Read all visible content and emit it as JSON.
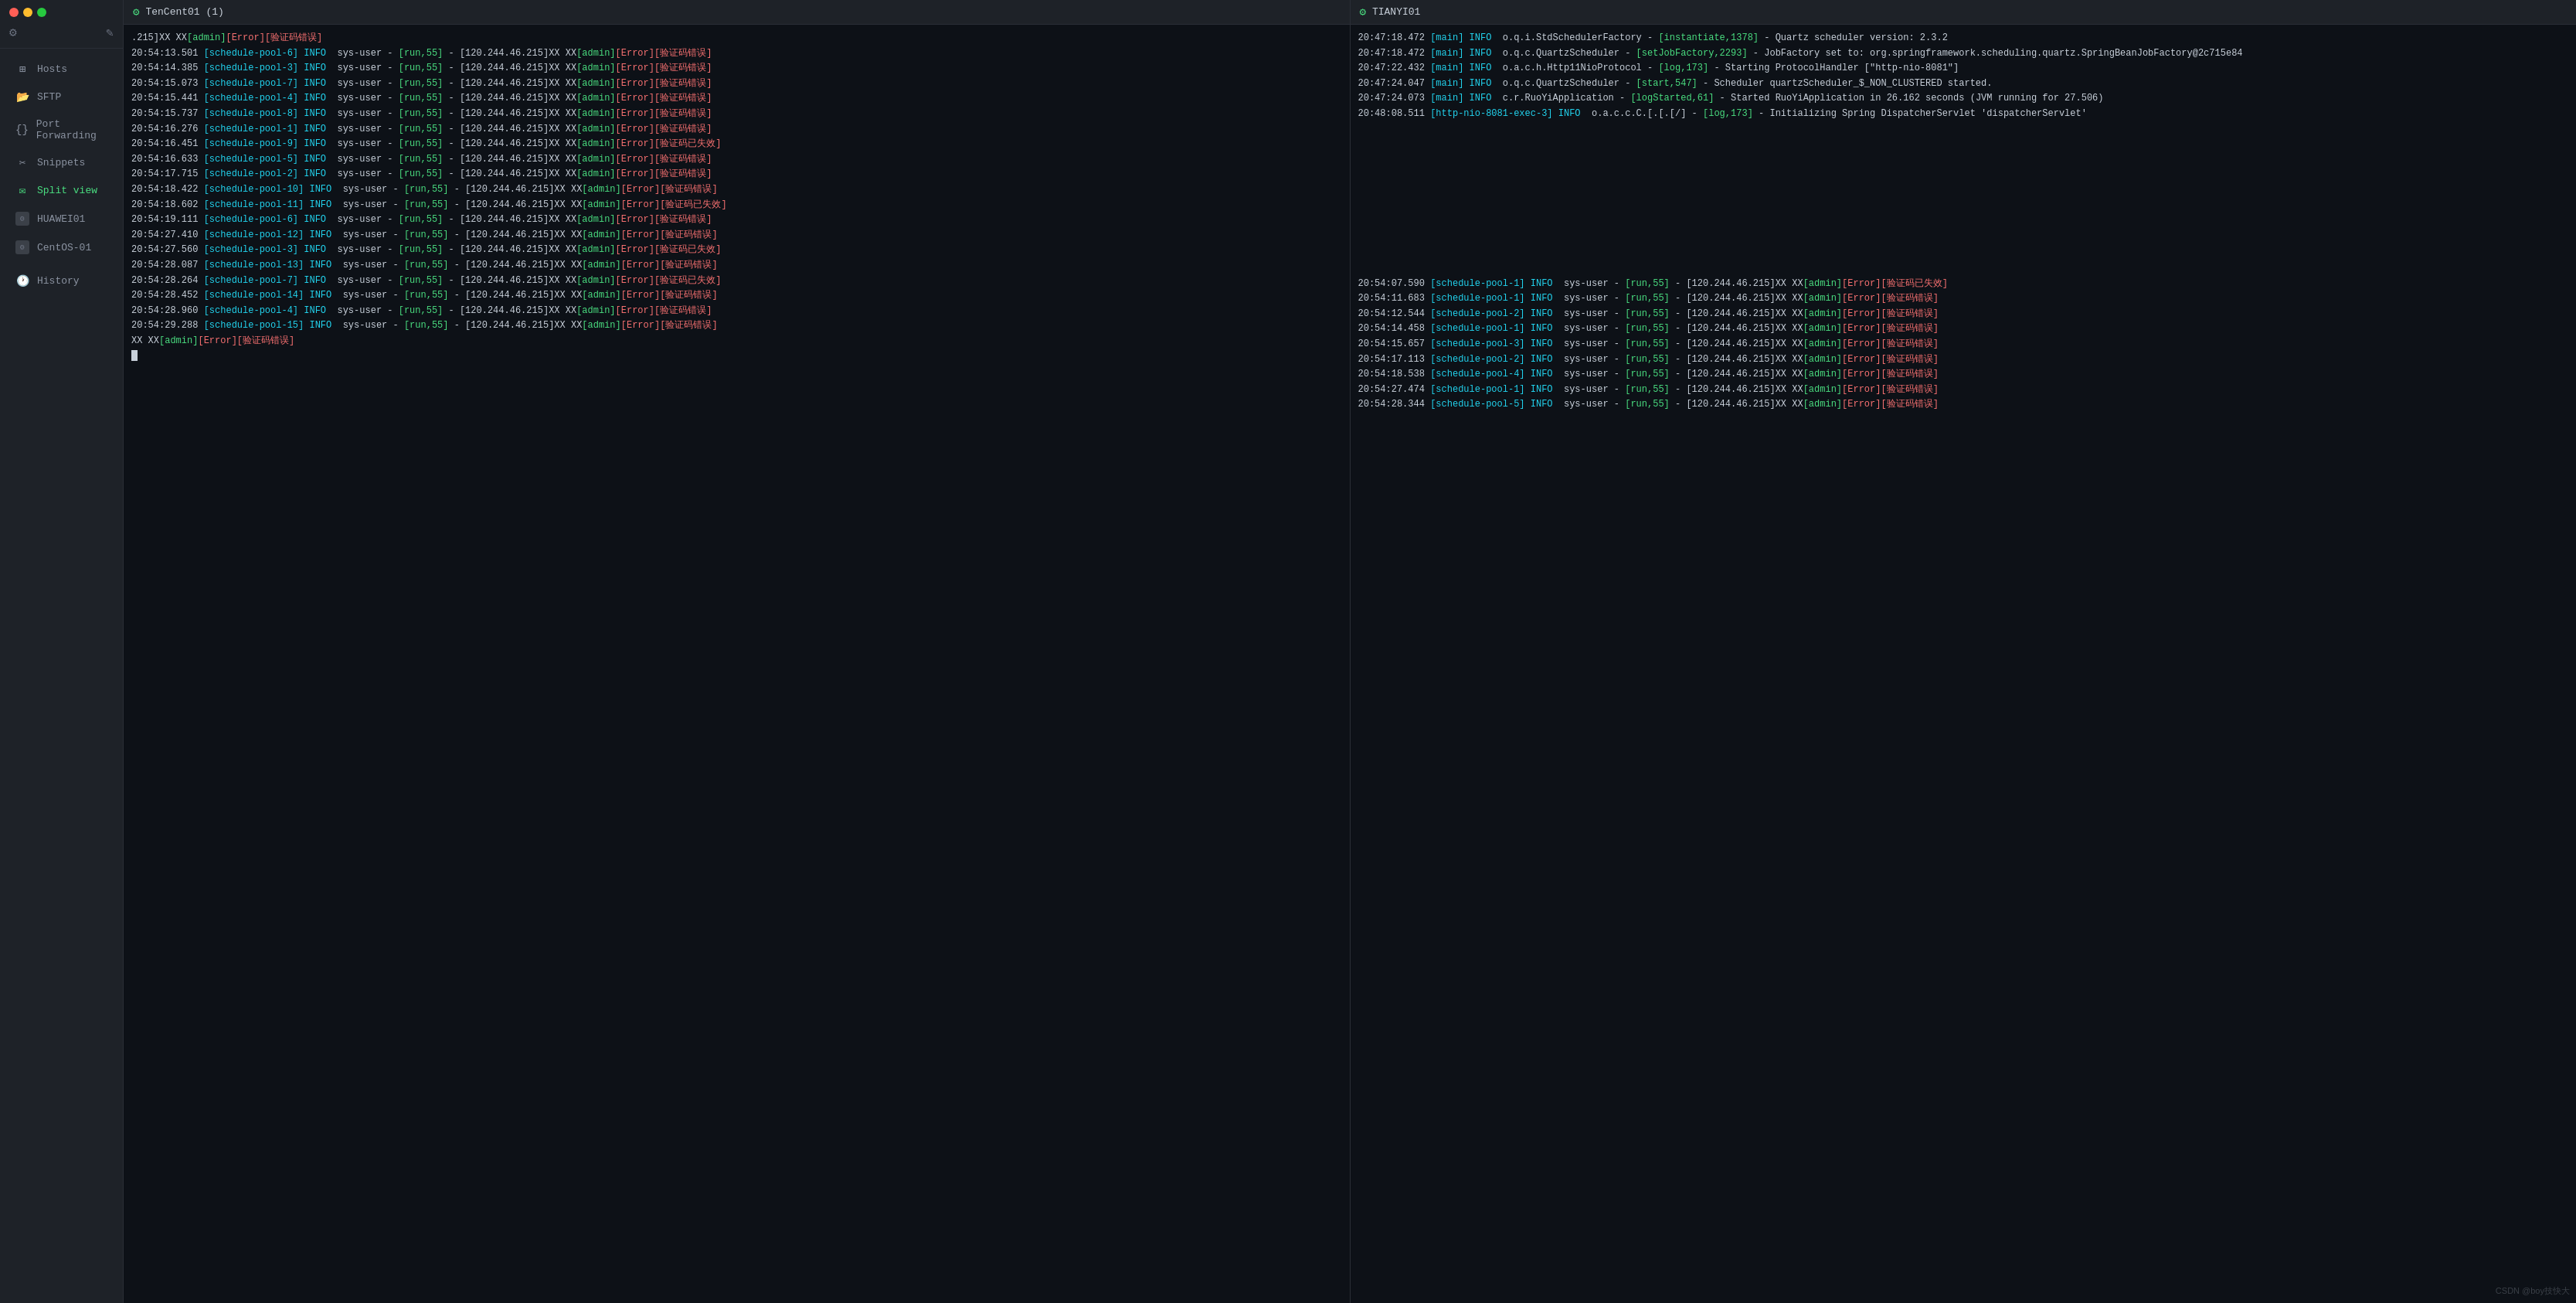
{
  "sidebar": {
    "gear_icon": "⚙",
    "edit_icon": "✎",
    "nav_items": [
      {
        "id": "hosts",
        "label": "Hosts",
        "icon": "⊞"
      },
      {
        "id": "sftp",
        "label": "SFTP",
        "icon": "📁"
      },
      {
        "id": "port-forwarding",
        "label": "Port Forwarding",
        "icon": "{}"
      },
      {
        "id": "snippets",
        "label": "Snippets",
        "icon": "✂"
      },
      {
        "id": "split-view",
        "label": "Split view",
        "icon": "✉",
        "active": true
      }
    ],
    "session_items": [
      {
        "id": "huawei01",
        "label": "HUAWEI01"
      },
      {
        "id": "centos-01",
        "label": "CentOS-01"
      }
    ],
    "history_label": "History"
  },
  "left_pane": {
    "title": "TenCent01 (1)",
    "gear_icon": "⚙",
    "logs": [
      ".215]XX XX[admin][Error][验证码错误]",
      "20:54:13.501 [schedule-pool-6] INFO  sys-user - [run,55] - [120.244.46.215]XX XX[admin][Error][验证码错误]",
      "20:54:14.385 [schedule-pool-3] INFO  sys-user - [run,55] - [120.244.46.215]XX XX[admin][Error][验证码错误]",
      "20:54:15.073 [schedule-pool-7] INFO  sys-user - [run,55] - [120.244.46.215]XX XX[admin][Error][验证码错误]",
      "20:54:15.441 [schedule-pool-4] INFO  sys-user - [run,55] - [120.244.46.215]XX XX[admin][Error][验证码错误]",
      "20:54:15.737 [schedule-pool-8] INFO  sys-user - [run,55] - [120.244.46.215]XX XX[admin][Error][验证码错误]",
      "20:54:16.276 [schedule-pool-1] INFO  sys-user - [run,55] - [120.244.46.215]XX XX[admin][Error][验证码错误]",
      "20:54:16.451 [schedule-pool-9] INFO  sys-user - [run,55] - [120.244.46.215]XX XX[admin][Error][验证码已失效]",
      "20:54:16.633 [schedule-pool-5] INFO  sys-user - [run,55] - [120.244.46.215]XX XX[admin][Error][验证码错误]",
      "20:54:17.715 [schedule-pool-2] INFO  sys-user - [run,55] - [120.244.46.215]XX XX[admin][Error][验证码错误]",
      "20:54:18.422 [schedule-pool-10] INFO  sys-user - [run,55] - [120.244.46.215]XX XX[admin][Error][验证码错误]",
      "20:54:18.602 [schedule-pool-11] INFO  sys-user - [run,55] - [120.244.46.215]XX XX[admin][Error][验证码已失效]",
      "20:54:19.111 [schedule-pool-6] INFO  sys-user - [run,55] - [120.244.46.215]XX XX[admin][Error][验证码错误]",
      "20:54:27.410 [schedule-pool-12] INFO  sys-user - [run,55] - [120.244.46.215]XX XX[admin][Error][验证码错误]",
      "20:54:27.560 [schedule-pool-3] INFO  sys-user - [run,55] - [120.244.46.215]XX XX[admin][Error][验证码已失效]",
      "20:54:28.087 [schedule-pool-13] INFO  sys-user - [run,55] - [120.244.46.215]XX XX[admin][Error][验证码错误]",
      "20:54:28.264 [schedule-pool-7] INFO  sys-user - [run,55] - [120.244.46.215]XX XX[admin][Error][验证码已失效]",
      "20:54:28.452 [schedule-pool-14] INFO  sys-user - [run,55] - [120.244.46.215]XX XX[admin][Error][验证码错误]",
      "20:54:28.960 [schedule-pool-4] INFO  sys-user - [run,55] - [120.244.46.215]XX XX[admin][Error][验证码错误]",
      "20:54:29.288 [schedule-pool-15] INFO  sys-user - [run,55] - [120.244.46.215]XX XX[admin][Error][验证码错误]",
      "XX XX[admin][Error][验证码错误]"
    ]
  },
  "right_pane": {
    "title": "TIANYI01",
    "gear_icon": "⚙",
    "logs_top": [
      "20:47:18.472 [main] INFO  o.q.i.StdSchedulerFactory - [instantiate,1378] - Quartz scheduler version: 2.3.2",
      "20:47:18.472 [main] INFO  o.q.c.QuartzScheduler - [setJobFactory,2293] - JobFactory set to: org.springframework.scheduling.quartz.SpringBeanJobFactory@2c715e84",
      "20:47:22.432 [main] INFO  o.a.c.h.Http11NioProtocol - [log,173] - Starting ProtocolHandler [\"http-nio-8081\"]",
      "20:47:24.047 [main] INFO  o.q.c.QuartzScheduler - [start,547] - Scheduler quartzScheduler_$_NON_CLUSTERED started.",
      "20:47:24.073 [main] INFO  c.r.RuoYiApplication - [logStarted,61] - Started RuoYiApplication in 26.162 seconds (JVM running for 27.506)",
      "20:48:08.511 [http-nio-8081-exec-3] INFO  o.a.c.c.C.[.[.[/] - [log,173] - Initializing Spring DispatcherServlet 'dispatcherServlet'"
    ],
    "logs_bottom": [
      "20:54:07.590 [schedule-pool-1] INFO  sys-user - [run,55] - [120.244.46.215]XX XX[admin][Error][验证码已失效]",
      "20:54:11.683 [schedule-pool-1] INFO  sys-user - [run,55] - [120.244.46.215]XX XX[admin][Error][验证码错误]",
      "20:54:12.544 [schedule-pool-2] INFO  sys-user - [run,55] - [120.244.46.215]XX XX[admin][Error][验证码错误]",
      "20:54:14.458 [schedule-pool-1] INFO  sys-user - [run,55] - [120.244.46.215]XX XX[admin][Error][验证码错误]",
      "20:54:15.657 [schedule-pool-3] INFO  sys-user - [run,55] - [120.244.46.215]XX XX[admin][Error][验证码错误]",
      "20:54:17.113 [schedule-pool-2] INFO  sys-user - [run,55] - [120.244.46.215]XX XX[admin][Error][验证码错误]",
      "20:54:18.538 [schedule-pool-4] INFO  sys-user - [run,55] - [120.244.46.215]XX XX[admin][Error][验证码错误]",
      "20:54:27.474 [schedule-pool-1] INFO  sys-user - [run,55] - [120.244.46.215]XX XX[admin][Error][验证码错误]",
      "20:54:28.344 [schedule-pool-5] INFO  sys-user - [run,55] - [120.244.46.215]XX XX[admin][Error][验证码错误]"
    ]
  },
  "watermark": "CSDN @boy技快大"
}
